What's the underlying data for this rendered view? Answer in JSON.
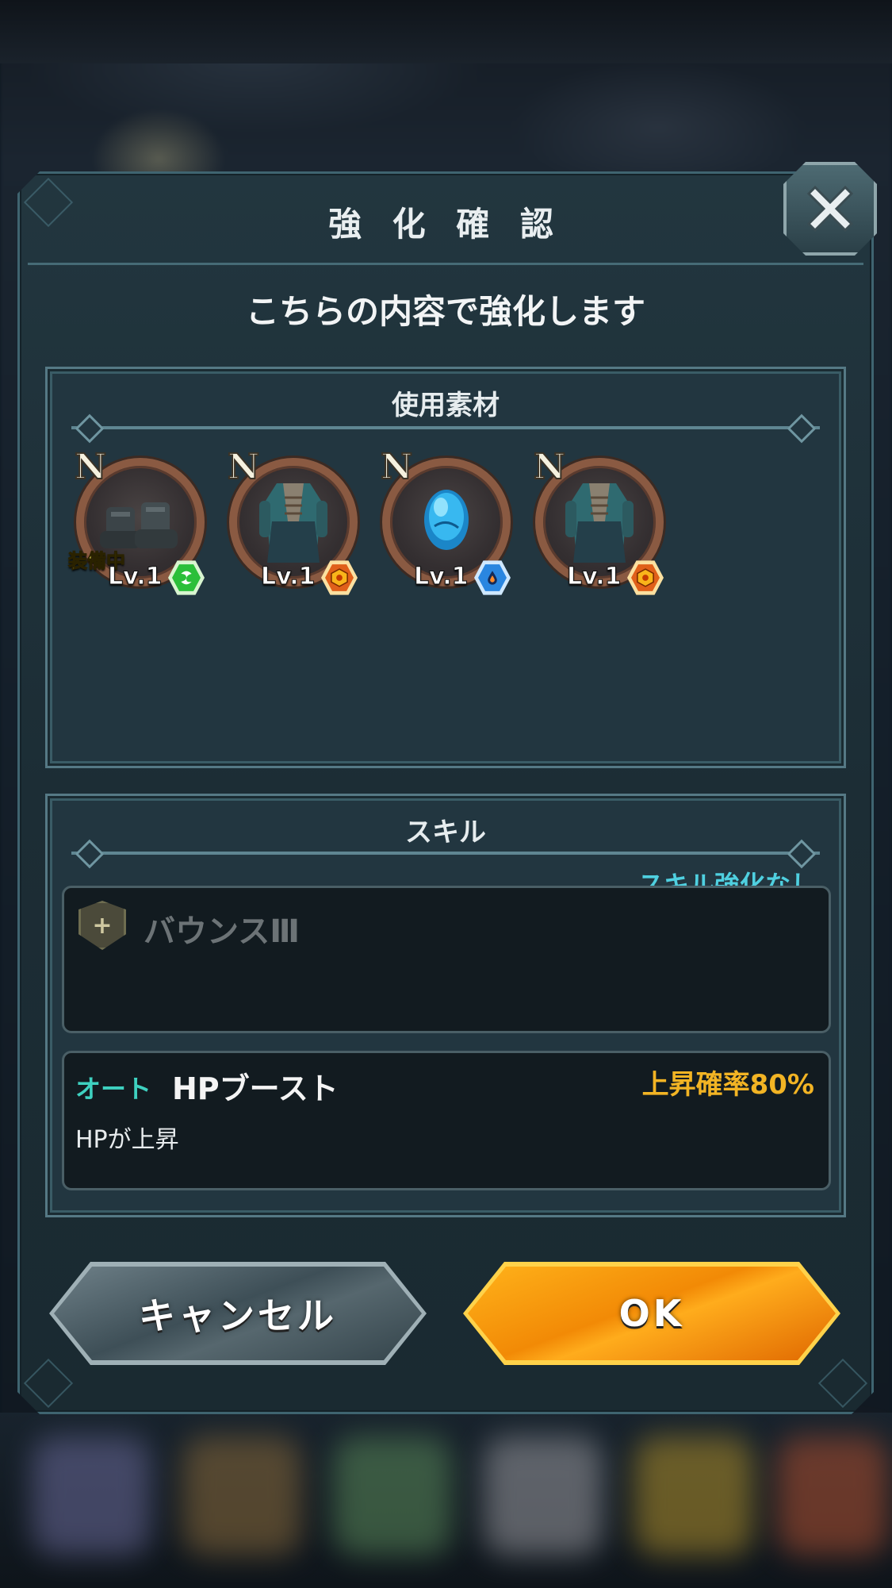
{
  "dialog": {
    "title": "強 化 確 認",
    "subtitle": "こちらの内容で強化します",
    "close_icon": "close-icon"
  },
  "materials": {
    "header": "使用素材",
    "items": [
      {
        "rarity": "N",
        "level": "Lv.1",
        "equipped_label": "装備中",
        "item": "boots",
        "element": "wind",
        "element_color": "#2bbf3a"
      },
      {
        "rarity": "N",
        "level": "Lv.1",
        "equipped_label": "",
        "item": "coat",
        "element": "fire",
        "element_color": "#e0601a"
      },
      {
        "rarity": "N",
        "level": "Lv.1",
        "equipped_label": "",
        "item": "blue-orb",
        "element": "water",
        "element_color": "#2a86e0"
      },
      {
        "rarity": "N",
        "level": "Lv.1",
        "equipped_label": "",
        "item": "coat",
        "element": "fire",
        "element_color": "#e0601a"
      }
    ]
  },
  "skill": {
    "header": "スキル",
    "status": "スキル強化なし",
    "current": {
      "name": "バウンスⅢ",
      "icon": "shield-plus-icon"
    },
    "auto": {
      "tag": "オート",
      "name": "HPブースト",
      "rate": "上昇確率80%",
      "description": "HPが上昇"
    }
  },
  "buttons": {
    "cancel": "キャンセル",
    "ok": "OK"
  },
  "colors": {
    "ok_button": "#f28a06",
    "cancel_button": "#4a5b62",
    "accent_cyan": "#4fd0e0",
    "rate_gold": "#f2b424"
  }
}
